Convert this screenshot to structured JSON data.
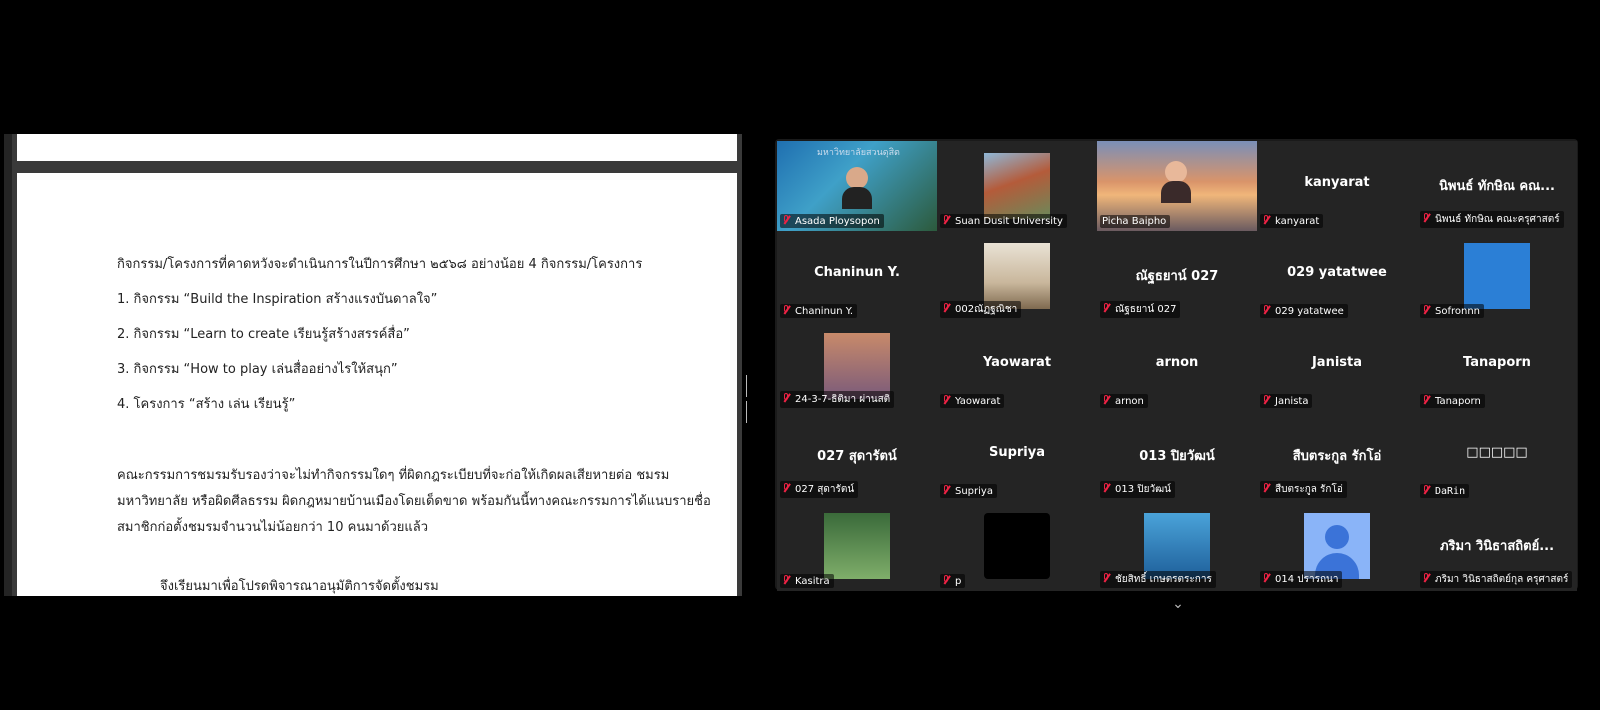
{
  "document": {
    "lines": [
      "กิจกรรม/โครงการที่คาดหวังจะดำเนินการในปีการศึกษา ๒๕๖๘  อย่างน้อย 4 กิจกรรม/โครงการ",
      "1.  กิจกรรม “Build the Inspiration สร้างแรงบันดาลใจ”",
      "2.  กิจกรรม “Learn to create เรียนรู้สร้างสรรค์สื่อ”",
      "3.  กิจกรรม “How to play เล่นสื่ออย่างไรให้สนุก”",
      "4.  โครงการ “สร้าง เล่น เรียนรู้”",
      "คณะกรรมการชมรมรับรองว่าจะไม่ทำกิจกรรมใดๆ ที่ผิดกฎระเบียบที่จะก่อให้เกิดผลเสียหายต่อ ชมรม",
      "มหาวิทยาลัย หรือผิดศีลธรรม ผิดกฎหมายบ้านเมืองโดยเด็ดขาด พร้อมกันนี้ทางคณะกรรมการได้แนบรายชื่อ",
      "สมาชิกก่อตั้งชมรมจำนวนไม่น้อยกว่า  10  คนมาด้วยแล้ว",
      "จึงเรียนมาเพื่อโปรดพิจารณาอนุมัติการจัดตั้งชมรม"
    ]
  },
  "tile_banner_text": "มหาวิทยาลัยสวนดุสิต",
  "participants": [
    {
      "label": "Asada Ploysopon",
      "center": ""
    },
    {
      "label": "Suan Dusit University",
      "center": ""
    },
    {
      "label": "Picha Baipho",
      "center": ""
    },
    {
      "label": "kanyarat",
      "center": "kanyarat"
    },
    {
      "label": "นิพนธ์ ทักษิณ คณะครุศาสตร์",
      "center": "นิพนธ์ ทักษิณ คณ..."
    },
    {
      "label": "Chaninun Y.",
      "center": "Chaninun Y."
    },
    {
      "label": "002ณัฏฐณิชา",
      "center": ""
    },
    {
      "label": "ณัฐธยาน์ 027",
      "center": "ณัฐธยาน์ 027"
    },
    {
      "label": "029 yatatwee",
      "center": "029 yatatwee"
    },
    {
      "label": "Sofronnn",
      "center": ""
    },
    {
      "label": "24-3-7-ธิติมา ผ่านสติ",
      "center": ""
    },
    {
      "label": "Yaowarat",
      "center": "Yaowarat"
    },
    {
      "label": "arnon",
      "center": "arnon"
    },
    {
      "label": "Janista",
      "center": "Janista"
    },
    {
      "label": "Tanaporn",
      "center": "Tanaporn"
    },
    {
      "label": "027 สุดารัตน์",
      "center": "027 สุดารัตน์"
    },
    {
      "label": "Supriya",
      "center": "Supriya"
    },
    {
      "label": "013 ปิยวัฒน์",
      "center": "013 ปิยวัฒน์"
    },
    {
      "label": "สืบตระกูล รักโอ่",
      "center": "สืบตระกูล รักโอ่"
    },
    {
      "label": "DaRin",
      "center": "□□□□□"
    },
    {
      "label": "Kasitra",
      "center": ""
    },
    {
      "label": "p",
      "center": ""
    },
    {
      "label": "ชัยสิทธิ์ เกษตรตระการ",
      "center": ""
    },
    {
      "label": "014 ปรารถนา",
      "center": ""
    },
    {
      "label": "ภริมา วินิธาสถิตย์กุล ครุศาสตร์",
      "center": "ภริมา วินิธาสถิตย์..."
    }
  ],
  "colors": {
    "active_speaker": "#3fc86a",
    "mute": "#e22244",
    "tile_bg": "#242424"
  }
}
